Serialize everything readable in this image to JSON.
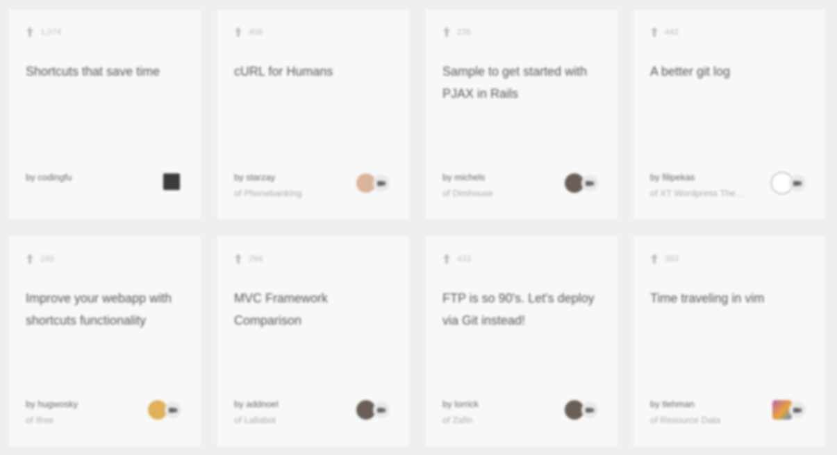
{
  "cards": [
    {
      "votes": "1,074",
      "title": "Shortcuts that save time",
      "by": "by codingfu",
      "org": "",
      "avatar": "face-pixel",
      "badge": false
    },
    {
      "votes": "408",
      "title": "cURL for Humans",
      "by": "by starzay",
      "org": "of Phonebanking",
      "avatar": "face-light",
      "badge": true
    },
    {
      "votes": "235",
      "title": "Sample to get started with PJAX in Rails",
      "by": "by michels",
      "org": "of Dimhouse",
      "avatar": "face-dark",
      "badge": true
    },
    {
      "votes": "442",
      "title": "A better git log",
      "by": "by filipekas",
      "org": "of XT Wordpress Theme",
      "avatar": "face-sketch",
      "badge": true
    },
    {
      "votes": "245",
      "title": "Improve your webapp with shortcuts functionality",
      "by": "by hugwosky",
      "org": "of Ifree",
      "avatar": "face-yellow",
      "badge": true
    },
    {
      "votes": "294",
      "title": "MVC Framework Comparison",
      "by": "by addnoel",
      "org": "of Lallabot",
      "avatar": "face-dark",
      "badge": true
    },
    {
      "votes": "433",
      "title": "FTP is so 90's. Let's deploy via Git instead!",
      "by": "by lorrick",
      "org": "of Zafin",
      "avatar": "face-dark",
      "badge": true
    },
    {
      "votes": "383",
      "title": "Time traveling in vim",
      "by": "by tlehman",
      "org": "of Resource Data",
      "avatar": "face-multi",
      "badge": true
    }
  ]
}
